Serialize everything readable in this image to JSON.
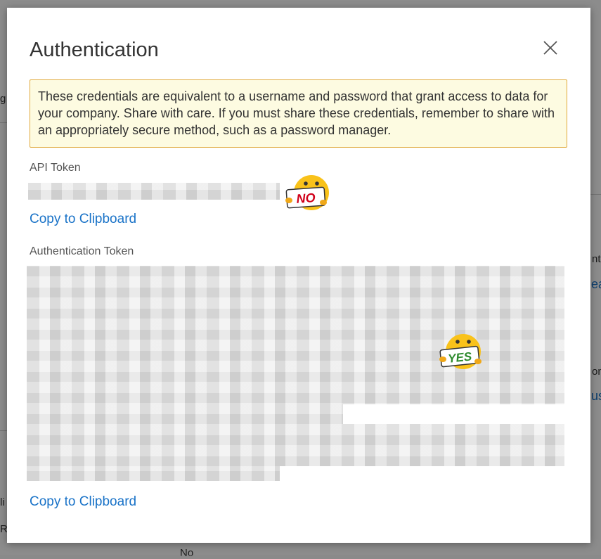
{
  "background": {
    "fragments": [
      {
        "text": "g"
      },
      {
        "text": "nt"
      },
      {
        "text": "ea"
      },
      {
        "text": "on"
      },
      {
        "text": "us"
      },
      {
        "text": "li"
      },
      {
        "text": "R"
      },
      {
        "text": "No"
      }
    ]
  },
  "modal": {
    "title": "Authentication",
    "close_icon": "close-icon",
    "warning": "These credentials are equivalent to a username and password that grant access to data for your company. Share with care. If you must share these credentials, remember to share with an appropriately secure method, such as a password manager.",
    "api_token": {
      "label": "API Token",
      "value_obscured": true,
      "copy_label": "Copy to Clipboard",
      "sticker_text": "NO"
    },
    "auth_token": {
      "label": "Authentication Token",
      "value_obscured": true,
      "copy_label": "Copy to Clipboard",
      "sticker_text": "YES"
    }
  },
  "colors": {
    "link": "#1a73c8",
    "warning_bg": "#fdfbe1",
    "warning_border": "#e0a93b",
    "no_sign": "#d0021b",
    "yes_sign": "#2e8b2e"
  }
}
